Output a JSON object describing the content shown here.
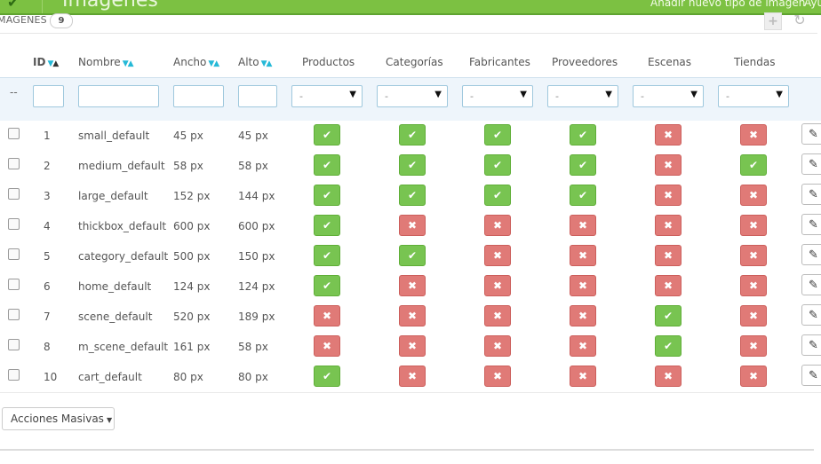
{
  "header": {
    "page_title": "Imágenes",
    "add_link": "Añadir nuevo tipo de imagen",
    "help_link": "Ayu"
  },
  "panel": {
    "title": "MAGENES",
    "count": "9"
  },
  "table": {
    "columns": [
      "ID",
      "Nombre",
      "Ancho",
      "Alto",
      "Productos",
      "Categorías",
      "Fabricantes",
      "Proveedores",
      "Escenas",
      "Tiendas"
    ],
    "filter_dash": "--",
    "select_default": "-",
    "rows": [
      {
        "id": "1",
        "name": "small_default",
        "width": "45 px",
        "height": "45 px",
        "flags": [
          true,
          true,
          true,
          true,
          false,
          false
        ]
      },
      {
        "id": "2",
        "name": "medium_default",
        "width": "58 px",
        "height": "58 px",
        "flags": [
          true,
          true,
          true,
          true,
          false,
          true
        ]
      },
      {
        "id": "3",
        "name": "large_default",
        "width": "152 px",
        "height": "144 px",
        "flags": [
          true,
          true,
          true,
          true,
          false,
          false
        ]
      },
      {
        "id": "4",
        "name": "thickbox_default",
        "width": "600 px",
        "height": "600 px",
        "flags": [
          true,
          false,
          false,
          false,
          false,
          false
        ]
      },
      {
        "id": "5",
        "name": "category_default",
        "width": "500 px",
        "height": "150 px",
        "flags": [
          true,
          true,
          false,
          false,
          false,
          false
        ]
      },
      {
        "id": "6",
        "name": "home_default",
        "width": "124 px",
        "height": "124 px",
        "flags": [
          true,
          false,
          false,
          false,
          false,
          false
        ]
      },
      {
        "id": "7",
        "name": "scene_default",
        "width": "520 px",
        "height": "189 px",
        "flags": [
          false,
          false,
          false,
          false,
          true,
          false
        ]
      },
      {
        "id": "8",
        "name": "m_scene_default",
        "width": "161 px",
        "height": "58 px",
        "flags": [
          false,
          false,
          false,
          false,
          true,
          false
        ]
      },
      {
        "id": "10",
        "name": "cart_default",
        "width": "80 px",
        "height": "80 px",
        "flags": [
          true,
          false,
          false,
          false,
          false,
          false
        ]
      }
    ]
  },
  "footer": {
    "bulk_label": "Acciones Masivas"
  },
  "colors": {
    "top_bar": "#7cc142",
    "enabled": "#78c451",
    "disabled": "#e07a77",
    "sort_accent": "#25b9d7"
  },
  "icons": {
    "enabled": "check-icon",
    "disabled": "cross-icon",
    "edit": "pencil-icon",
    "sort": "sort-arrows-icon"
  }
}
